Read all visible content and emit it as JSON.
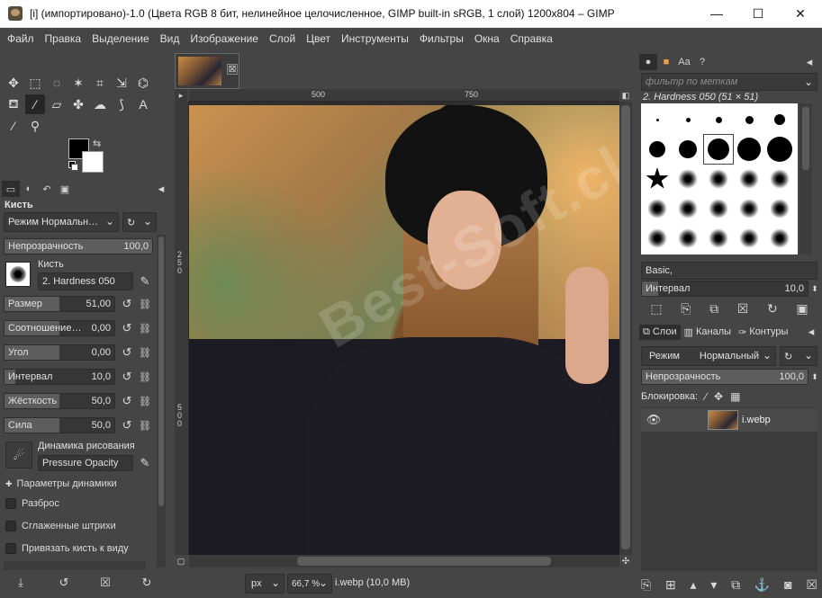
{
  "window": {
    "title": "[i] (импортировано)-1.0 (Цвета RGB 8 бит, нелинейное целочисленное, GIMP built-in sRGB, 1 слой) 1200x804 – GIMP",
    "minimize": "—",
    "maximize": "☐",
    "close": "✕"
  },
  "menu": [
    "Файл",
    "Правка",
    "Выделение",
    "Вид",
    "Изображение",
    "Слой",
    "Цвет",
    "Инструменты",
    "Фильтры",
    "Окна",
    "Справка"
  ],
  "toolbox": {
    "tools": [
      {
        "name": "move-tool-icon",
        "glyph": "✥"
      },
      {
        "name": "rect-select-tool-icon",
        "glyph": "⬚"
      },
      {
        "name": "lasso-tool-icon",
        "glyph": "◌"
      },
      {
        "name": "fuzzy-select-tool-icon",
        "glyph": "✶"
      },
      {
        "name": "crop-tool-icon",
        "glyph": "⌗"
      },
      {
        "name": "transform-tool-icon",
        "glyph": "⇲"
      },
      {
        "name": "warp-tool-icon",
        "glyph": "⌬"
      },
      {
        "name": "bucket-fill-tool-icon",
        "glyph": "⛾"
      },
      {
        "name": "paintbrush-tool-icon",
        "glyph": "∕"
      },
      {
        "name": "eraser-tool-icon",
        "glyph": "▱"
      },
      {
        "name": "clone-tool-icon",
        "glyph": "✤"
      },
      {
        "name": "smudge-tool-icon",
        "glyph": "☁"
      },
      {
        "name": "path-tool-icon",
        "glyph": "⟆"
      },
      {
        "name": "text-tool-icon",
        "glyph": "A"
      },
      {
        "name": "color-picker-tool-icon",
        "glyph": "⁄"
      },
      {
        "name": "zoom-tool-icon",
        "glyph": "⚲"
      }
    ],
    "options_title": "Кисть",
    "mode": "Режим Нормальн…",
    "opacity_label": "Непрозрачность",
    "opacity_value": "100,0",
    "opacity_fraction": 1.0,
    "brush_label": "Кисть",
    "brush_name": "2. Hardness 050",
    "sliders": [
      {
        "label": "Размер",
        "value": "51,00",
        "fraction": 0.5
      },
      {
        "label": "Соотношение…",
        "value": "0,00",
        "fraction": 0.5
      },
      {
        "label": "Угол",
        "value": "0,00",
        "fraction": 0.5
      },
      {
        "label": "Интервал",
        "value": "10,0",
        "fraction": 0.1
      },
      {
        "label": "Жёсткость",
        "value": "50,0",
        "fraction": 0.5
      },
      {
        "label": "Сила",
        "value": "50,0",
        "fraction": 0.5
      }
    ],
    "dynamics_label": "Динамика рисования",
    "dynamics_value": "Pressure Opacity",
    "dynamics_options": "Параметры динамики",
    "checkboxes": [
      "Разброс",
      "Сглаженные штрихи",
      "Привязать кисть к виду"
    ]
  },
  "canvas": {
    "tab_close": "⊠",
    "ruler_h": [
      "500",
      "750"
    ],
    "ruler_v": [
      "250",
      "500"
    ],
    "watermark": "Best-Soft.club",
    "unit": "px",
    "zoom": "66,7 %",
    "status": "i.webp (10,0 MB)"
  },
  "dock": {
    "filter_placeholder": "фильтр по меткам",
    "brush_title": "2. Hardness 050 (51 × 51)",
    "brush_set": "Basic,",
    "spacing_label": "Интервал",
    "spacing_value": "10,0",
    "spacing_fraction": 0.1,
    "tabs": {
      "layers": "Слои",
      "channels": "Каналы",
      "paths": "Контуры"
    },
    "mode_label": "Режим",
    "mode_value": "Нормальный",
    "opacity_label": "Непрозрачность",
    "opacity_value": "100,0",
    "opacity_fraction": 1.0,
    "lock_label": "Блокировка:",
    "layer_name": "i.webp"
  }
}
